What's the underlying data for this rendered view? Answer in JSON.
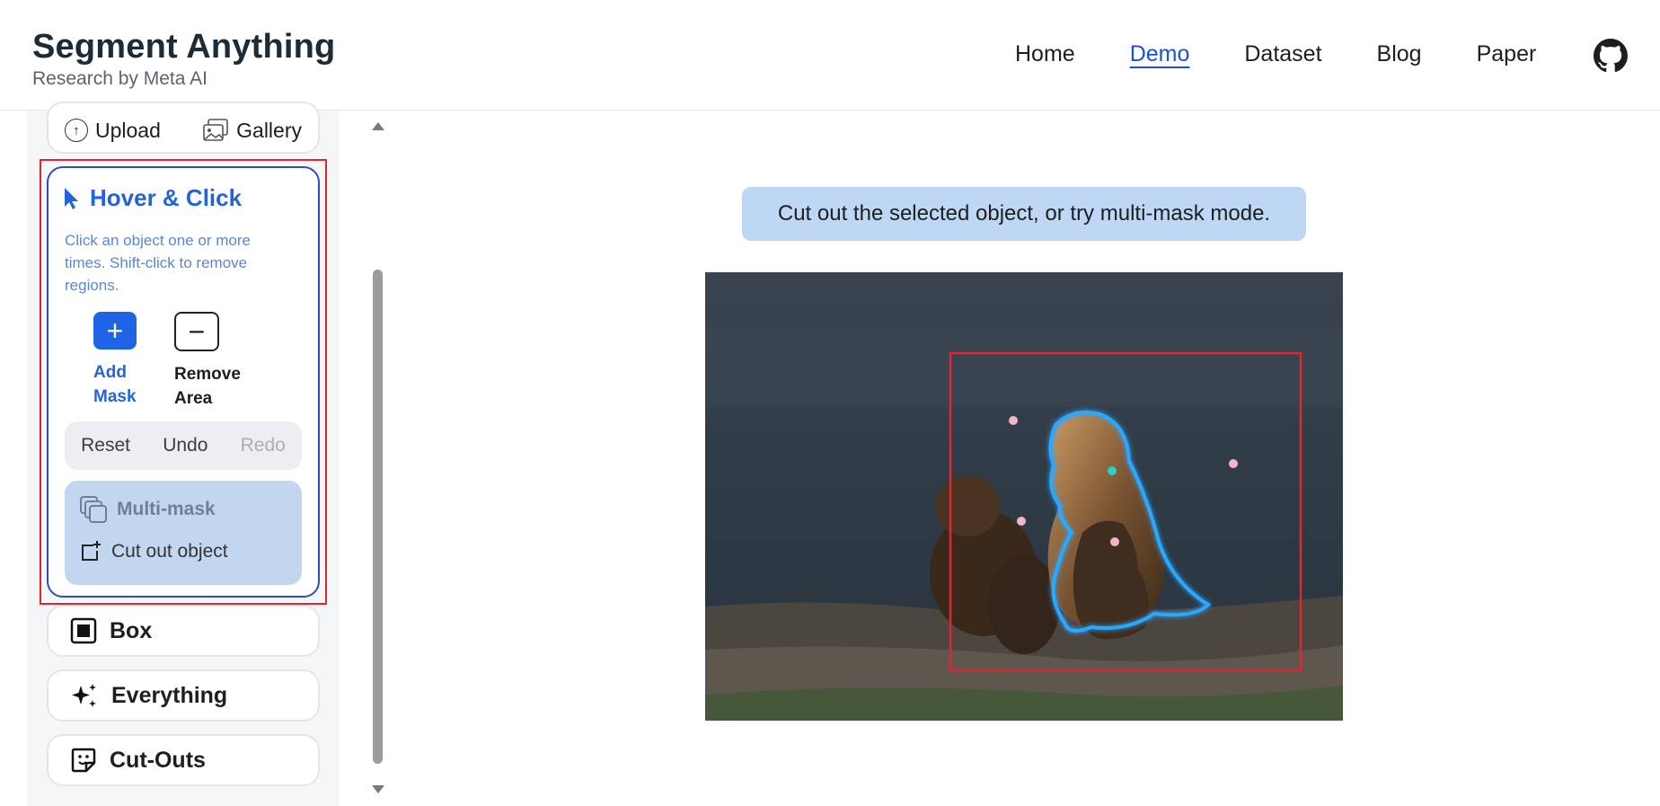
{
  "header": {
    "title": "Segment Anything",
    "subtitle": "Research by Meta AI",
    "nav": [
      "Home",
      "Demo",
      "Dataset",
      "Blog",
      "Paper"
    ],
    "active_nav": "Demo",
    "github_icon": "github-icon"
  },
  "sidebar": {
    "upload_label": "Upload",
    "gallery_label": "Gallery",
    "hover_click": {
      "title": "Hover & Click",
      "description": "Click an object one or more times. Shift-click to remove regions.",
      "add_mask_line1": "Add",
      "add_mask_line2": "Mask",
      "remove_area_line1": "Remove",
      "remove_area_line2": "Area",
      "reset": "Reset",
      "undo": "Undo",
      "redo": "Redo",
      "multimask": "Multi-mask",
      "cut_out": "Cut out object"
    },
    "box_label": "Box",
    "everything_label": "Everything",
    "cutouts_label": "Cut-Outs"
  },
  "main": {
    "tip": "Cut out the selected object, or try multi-mask mode."
  },
  "colors": {
    "accent": "#2563d8",
    "selection_box": "#e0262e",
    "mask_outline": "#29a8ff"
  }
}
